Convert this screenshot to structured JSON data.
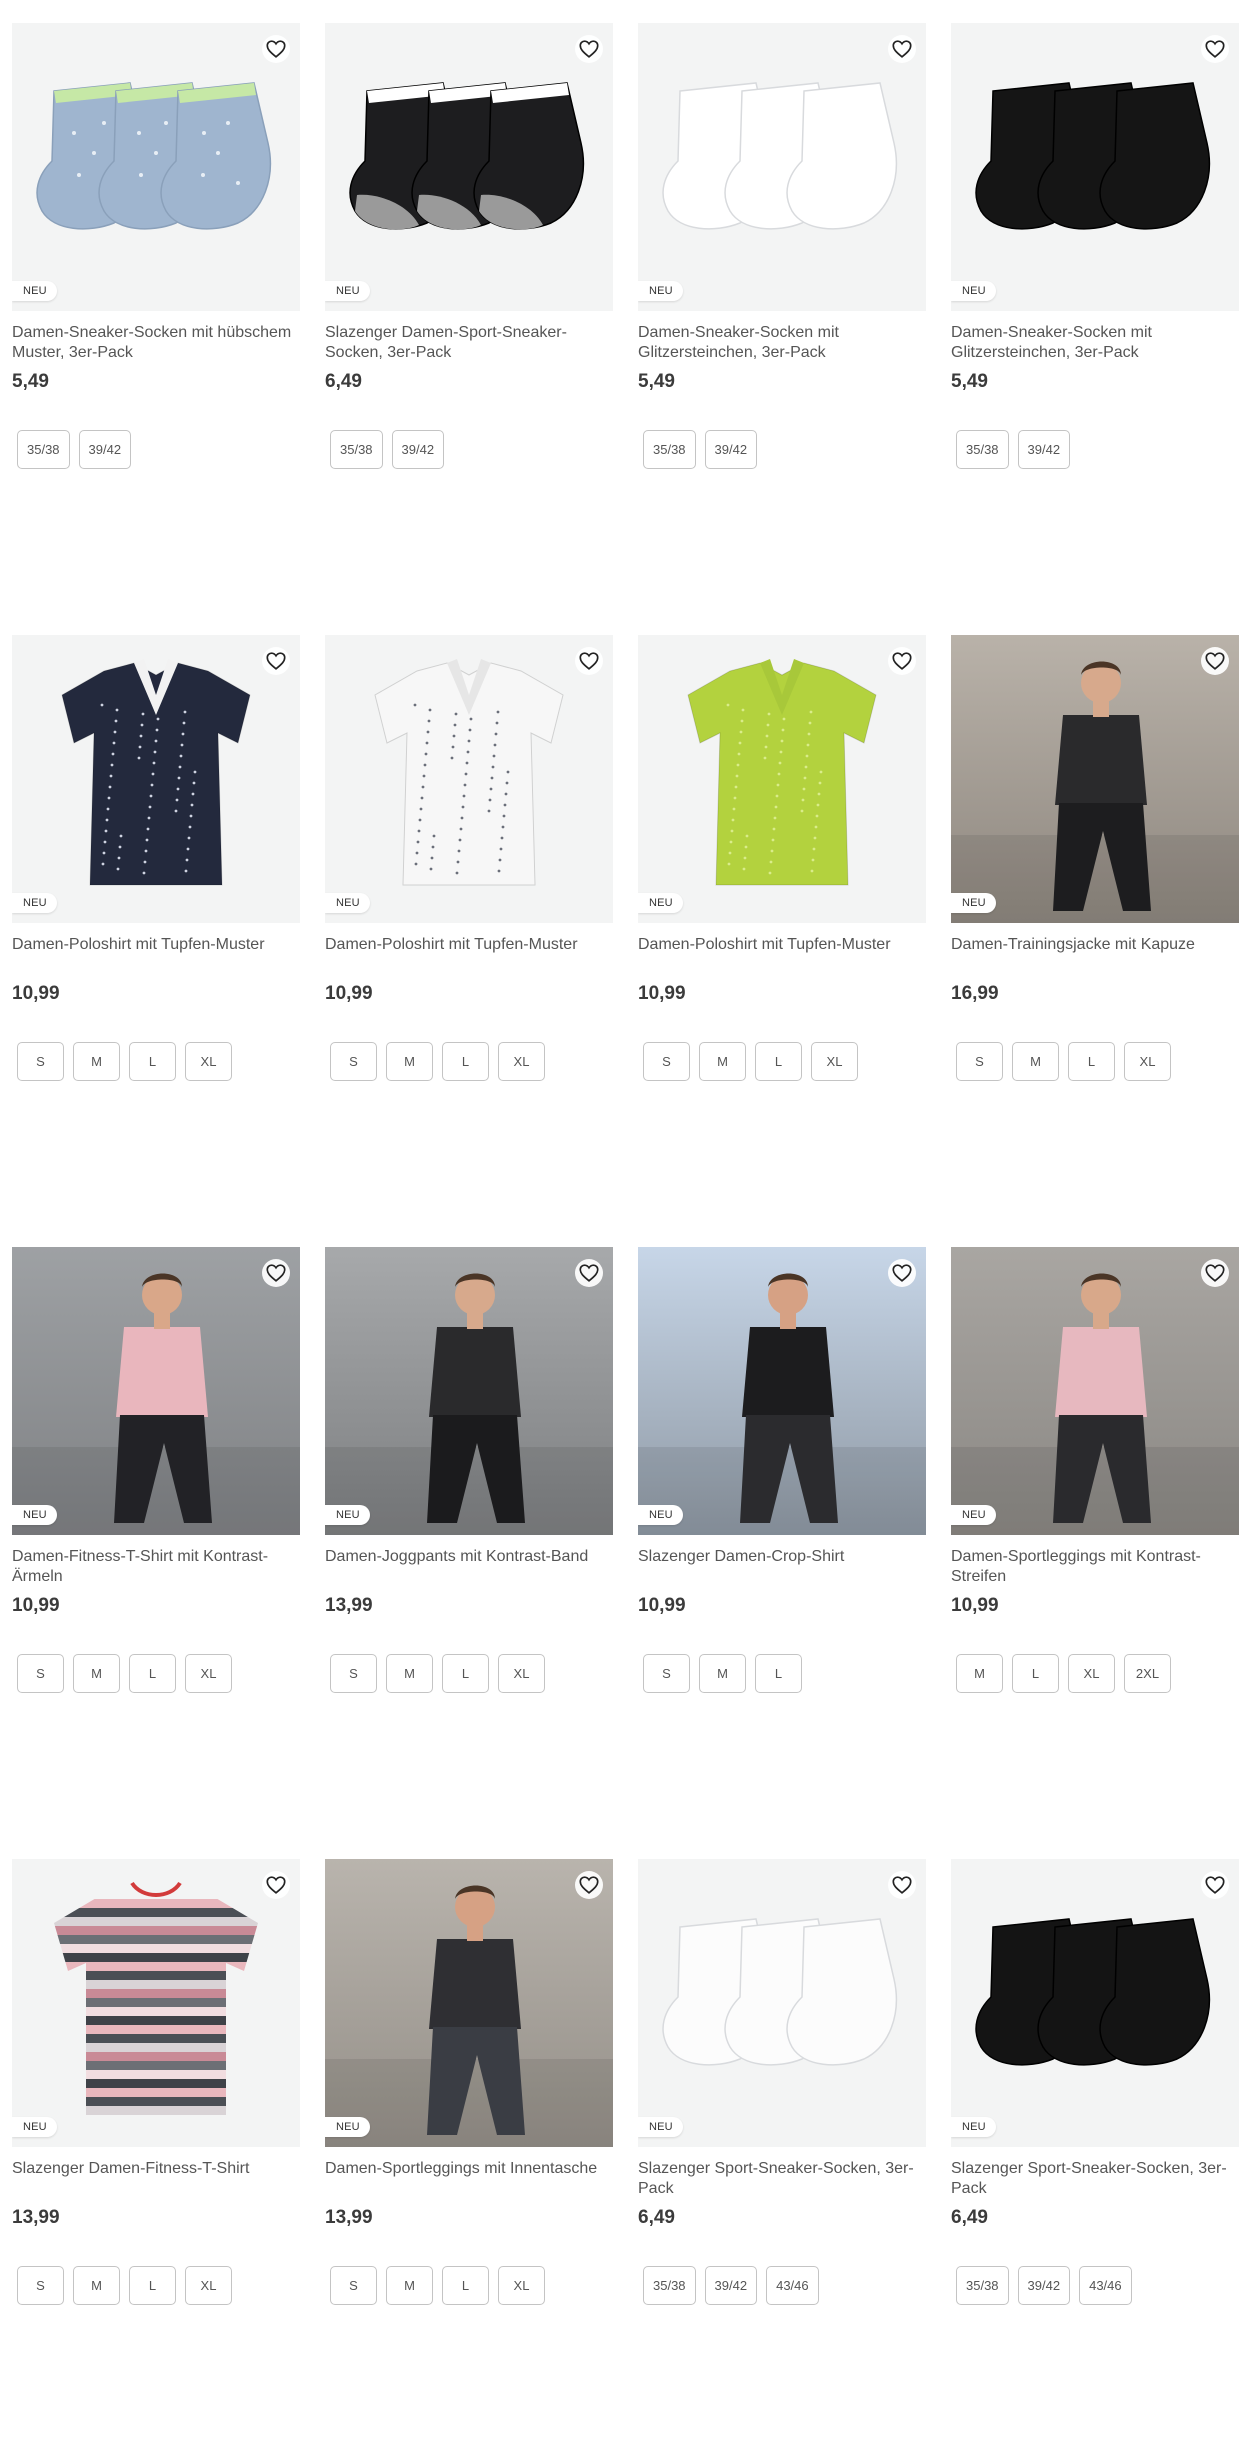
{
  "colors": {
    "badge_bg": "#ffffff",
    "price": "#3b3b3b",
    "title": "#555555",
    "size_border": "#c4c4c4",
    "image_bg": "#f3f4f4"
  },
  "products": [
    {
      "title": "Damen-Sneaker-Socken mit hübschem Muster, 3er-Pack",
      "price": "5,49",
      "badge": "NEU",
      "sizes": [
        "35/38",
        "39/42"
      ],
      "image": "blue-patterned-socks"
    },
    {
      "title": "Slazenger Damen-Sport-Sneaker-Socken, 3er-Pack",
      "price": "6,49",
      "badge": "NEU",
      "sizes": [
        "35/38",
        "39/42"
      ],
      "image": "black-grey-sport-socks"
    },
    {
      "title": "Damen-Sneaker-Socken mit Glitzersteinchen, 3er-Pack",
      "price": "5,49",
      "badge": "NEU",
      "sizes": [
        "35/38",
        "39/42"
      ],
      "image": "white-glitter-socks"
    },
    {
      "title": "Damen-Sneaker-Socken mit Glitzersteinchen, 3er-Pack",
      "price": "5,49",
      "badge": "NEU",
      "sizes": [
        "35/38",
        "39/42"
      ],
      "image": "black-glitter-socks"
    },
    {
      "title": "Damen-Poloshirt mit Tupfen-Muster",
      "price": "10,99",
      "badge": "NEU",
      "sizes": [
        "S",
        "M",
        "L",
        "XL"
      ],
      "image": "navy-polo"
    },
    {
      "title": "Damen-Poloshirt mit Tupfen-Muster",
      "price": "10,99",
      "badge": "NEU",
      "sizes": [
        "S",
        "M",
        "L",
        "XL"
      ],
      "image": "white-polo"
    },
    {
      "title": "Damen-Poloshirt mit Tupfen-Muster",
      "price": "10,99",
      "badge": "NEU",
      "sizes": [
        "S",
        "M",
        "L",
        "XL"
      ],
      "image": "lime-polo"
    },
    {
      "title": "Damen-Trainingsjacke mit Kapuze",
      "price": "16,99",
      "badge": "NEU",
      "sizes": [
        "S",
        "M",
        "L",
        "XL"
      ],
      "image": "training-jacket-photo"
    },
    {
      "title": "Damen-Fitness-T-Shirt mit Kontrast-Ärmeln",
      "price": "10,99",
      "badge": "NEU",
      "sizes": [
        "S",
        "M",
        "L",
        "XL"
      ],
      "image": "fitness-tshirt-photo"
    },
    {
      "title": "Damen-Joggpants mit Kontrast-Band",
      "price": "13,99",
      "badge": "NEU",
      "sizes": [
        "S",
        "M",
        "L",
        "XL"
      ],
      "image": "joggpants-photo"
    },
    {
      "title": "Slazenger Damen-Crop-Shirt",
      "price": "10,99",
      "badge": "NEU",
      "sizes": [
        "S",
        "M",
        "L"
      ],
      "image": "crop-shirt-photo"
    },
    {
      "title": "Damen-Sportleggings mit Kontrast-Streifen",
      "price": "10,99",
      "badge": "NEU",
      "sizes": [
        "M",
        "L",
        "XL",
        "2XL"
      ],
      "image": "sportleggings-photo"
    },
    {
      "title": "Slazenger Damen-Fitness-T-Shirt",
      "price": "13,99",
      "badge": "NEU",
      "sizes": [
        "S",
        "M",
        "L",
        "XL"
      ],
      "image": "striped-tshirt"
    },
    {
      "title": "Damen-Sportleggings mit Innentasche",
      "price": "13,99",
      "badge": "NEU",
      "sizes": [
        "S",
        "M",
        "L",
        "XL"
      ],
      "image": "leggings-innentasche-photo"
    },
    {
      "title": "Slazenger Sport-Sneaker-Socken, 3er-Pack",
      "price": "6,49",
      "badge": "NEU",
      "sizes": [
        "35/38",
        "39/42",
        "43/46"
      ],
      "image": "white-sport-socks"
    },
    {
      "title": "Slazenger Sport-Sneaker-Socken, 3er-Pack",
      "price": "6,49",
      "badge": "NEU",
      "sizes": [
        "35/38",
        "39/42",
        "43/46"
      ],
      "image": "black-sport-socks"
    }
  ]
}
